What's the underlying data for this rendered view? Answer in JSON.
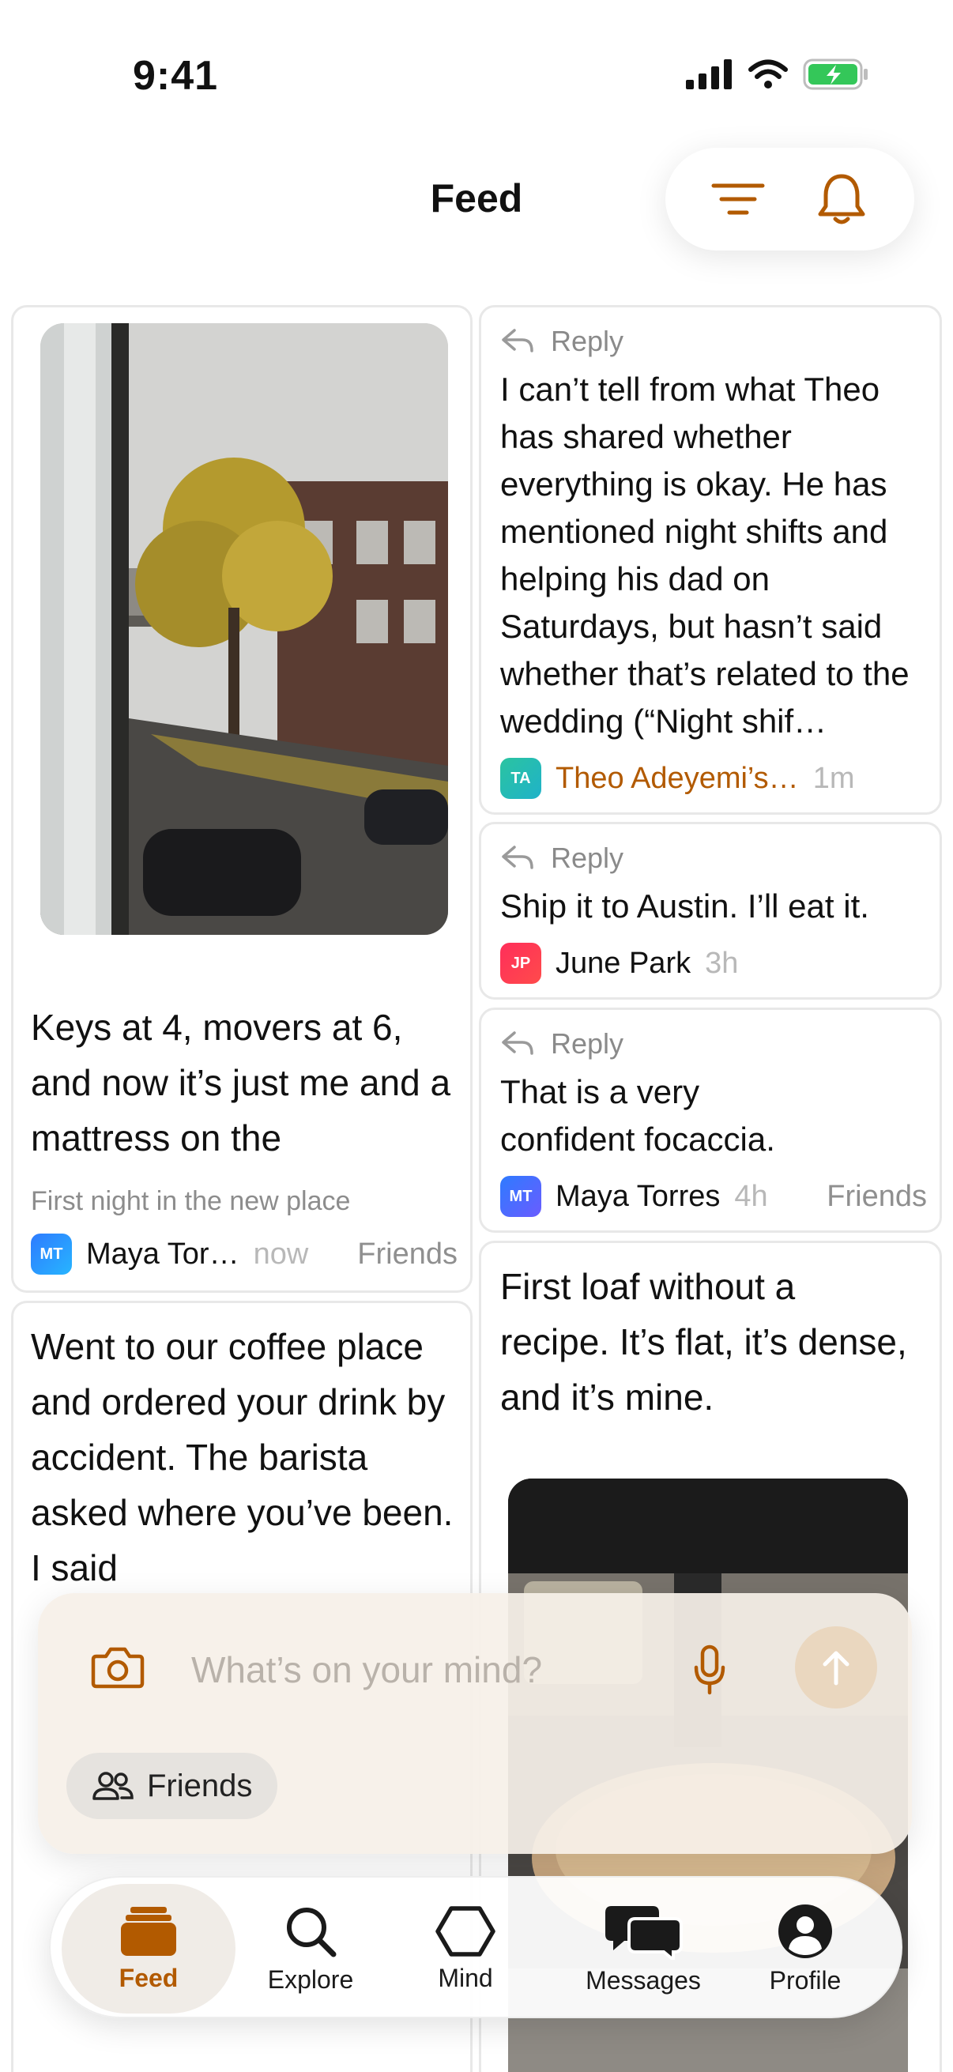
{
  "status_bar": {
    "time": "9:41"
  },
  "header": {
    "title": "Feed"
  },
  "colors": {
    "accent": "#b25a00",
    "send_button": "#ead7bf",
    "active_tab_bg": "#f0ece7"
  },
  "feed": {
    "left_column": [
      {
        "text": "Keys at 4, movers at 6, and now it’s just me and a mattress on the",
        "caption": "First night in the new place",
        "author_initials": "MT",
        "author": "Maya Tor…",
        "time": "now",
        "audience": "Friends"
      },
      {
        "text": "Went to our coffee place and ordered your drink by accident. The barista asked where you’ve been. I said"
      }
    ],
    "right_column": [
      {
        "reply_label": "Reply",
        "text": "I can’t tell from what Theo has shared whether everything is okay. He has mentioned night shifts and helping his dad on Saturdays, but hasn’t said whether that’s related to the wedding (“Night shif…",
        "author_initials": "TA",
        "author": "Theo Adeyemi’s…",
        "time": "1m"
      },
      {
        "reply_label": "Reply",
        "text": "Ship it to Austin. I’ll eat it.",
        "author_initials": "JP",
        "author": "June Park",
        "time": "3h"
      },
      {
        "reply_label": "Reply",
        "text": "That is a very confident focaccia.",
        "author_initials": "MT",
        "author": "Maya Torres",
        "time": "4h",
        "audience": "Friends"
      },
      {
        "text": "First loaf without a recipe. It’s flat, it’s dense, and it’s mine."
      }
    ]
  },
  "composer": {
    "placeholder": "What’s on your mind?",
    "audience": "Friends"
  },
  "tabbar": {
    "tabs": [
      {
        "label": "Feed",
        "icon": "feed-icon",
        "active": true
      },
      {
        "label": "Explore",
        "icon": "search-icon"
      },
      {
        "label": "Mind",
        "icon": "hexagon-icon"
      },
      {
        "label": "Messages",
        "icon": "messages-icon"
      },
      {
        "label": "Profile",
        "icon": "profile-icon"
      }
    ]
  }
}
